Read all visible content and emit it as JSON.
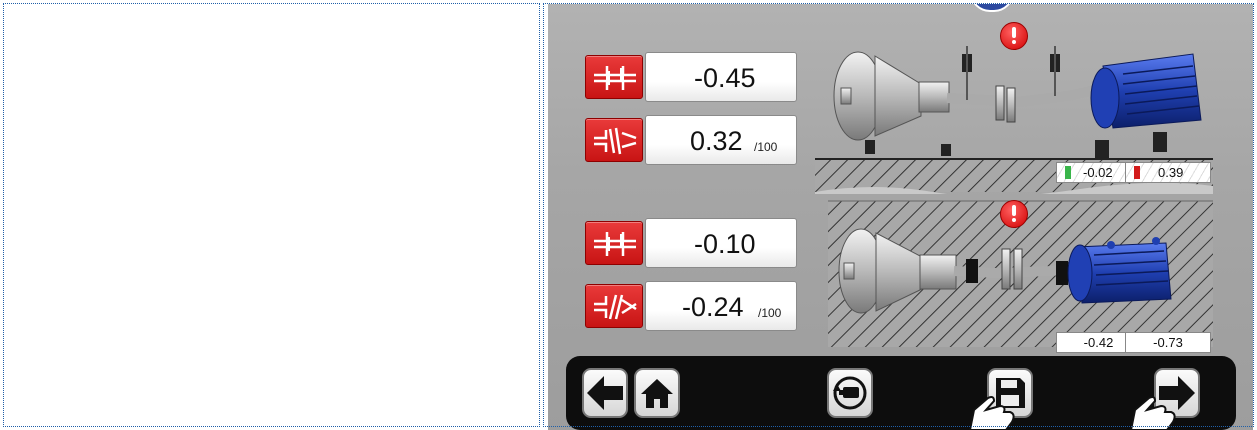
{
  "measurements": {
    "vertical": {
      "offset_value": "-0.45",
      "angle_value": "0.32",
      "angle_unit": "/100",
      "foot_front": "-0.02",
      "foot_rear": "0.39"
    },
    "horizontal": {
      "offset_value": "-0.10",
      "angle_value": "-0.24",
      "angle_unit": "/100",
      "foot_front": "-0.42",
      "foot_rear": "-0.73"
    }
  },
  "icons": {
    "offset_vertical": "offset-icon",
    "angle_vertical": "angle-icon",
    "offset_horizontal": "offset-icon",
    "angle_horizontal": "angle-icon",
    "warning": "exclamation-icon",
    "back": "arrow-left-icon",
    "home": "home-icon",
    "rotate": "rotate-machine-icon",
    "save": "floppy-disk-icon",
    "next": "arrow-right-icon"
  },
  "colors": {
    "accent_red": "#d31b1b",
    "toolbar": "#0d0d0d",
    "motor_blue": "#1f3fb0",
    "foot_green": "#39b54a"
  }
}
